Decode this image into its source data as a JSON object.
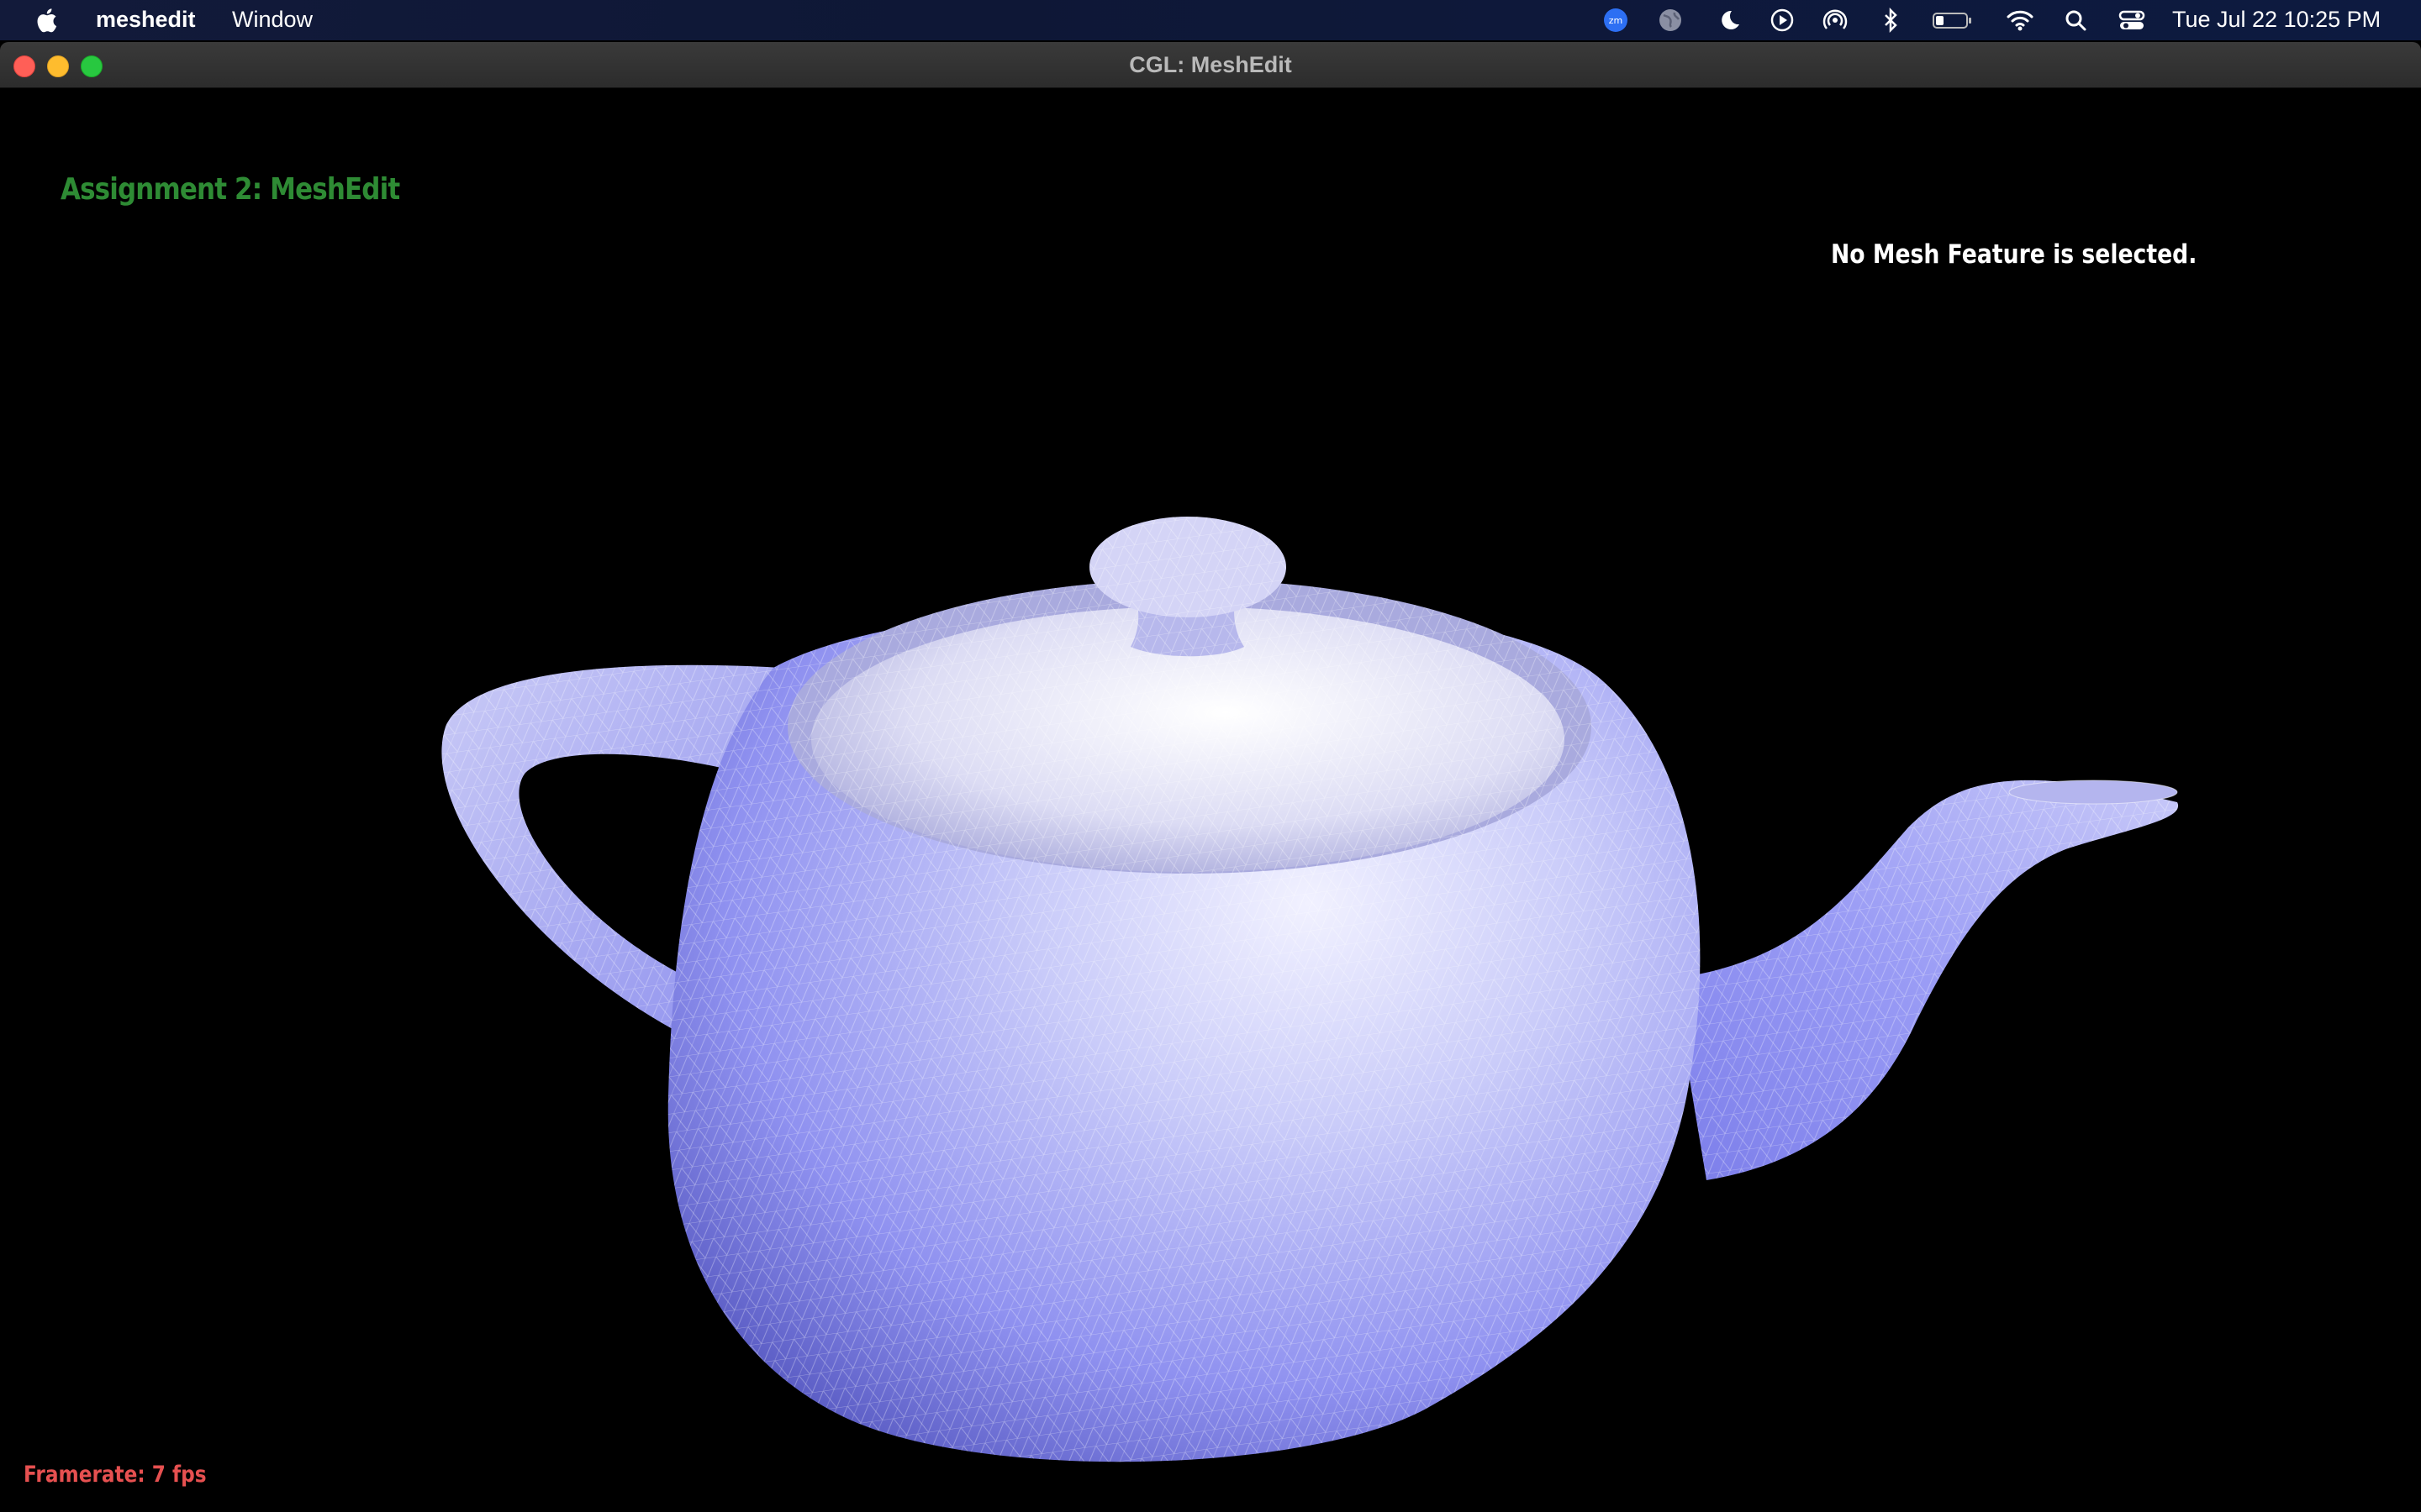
{
  "menubar": {
    "apple_icon": "apple-logo-icon",
    "app_name": "meshedit",
    "menus": [
      "Window"
    ],
    "status_icons": [
      "zoom-icon",
      "globe-icon",
      "moon-icon",
      "play-icon",
      "airdrop-icon",
      "bluetooth-icon",
      "battery-icon",
      "wifi-icon",
      "search-icon",
      "control-center-icon"
    ],
    "clock": "Tue Jul 22  10:25 PM"
  },
  "window": {
    "title": "CGL: MeshEdit"
  },
  "viewport": {
    "assignment_title": "Assignment 2: MeshEdit",
    "selection_status": "No Mesh Feature is selected.",
    "framerate": "Framerate: 7 fps",
    "mesh": "teapot",
    "mesh_color": "#9a9cf5",
    "wireframe_color": "#ffffff",
    "background_color": "#000000"
  },
  "colors": {
    "title_green": "#2e8b34",
    "framerate_red": "#e65050",
    "traffic_close": "#ff5f57",
    "traffic_min": "#febc2e",
    "traffic_max": "#28c840"
  }
}
